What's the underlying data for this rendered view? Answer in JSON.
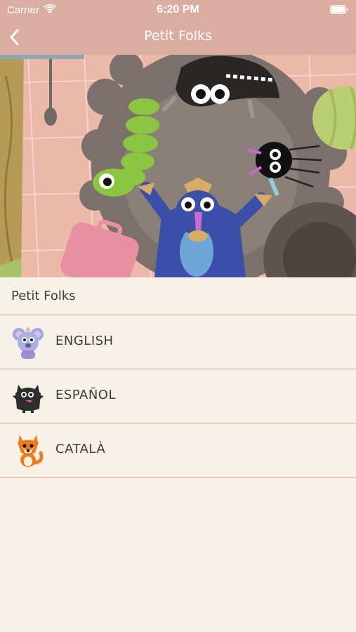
{
  "status_bar": {
    "carrier": "Carrier",
    "time": "6:20 PM"
  },
  "nav": {
    "title": "Petit Folks",
    "back_icon": "chevron-left-icon"
  },
  "section": {
    "header": "Petit Folks"
  },
  "languages": [
    {
      "label": "ENGLISH",
      "icon": "koala-character-icon"
    },
    {
      "label": "ESPAÑOL",
      "icon": "wolf-character-icon"
    },
    {
      "label": "CATALÀ",
      "icon": "fox-character-icon"
    }
  ],
  "colors": {
    "nav_background": "#dbaca0",
    "page_background": "#f8f1e7",
    "separator": "#d3a29a",
    "text": "#3d3d3d"
  }
}
